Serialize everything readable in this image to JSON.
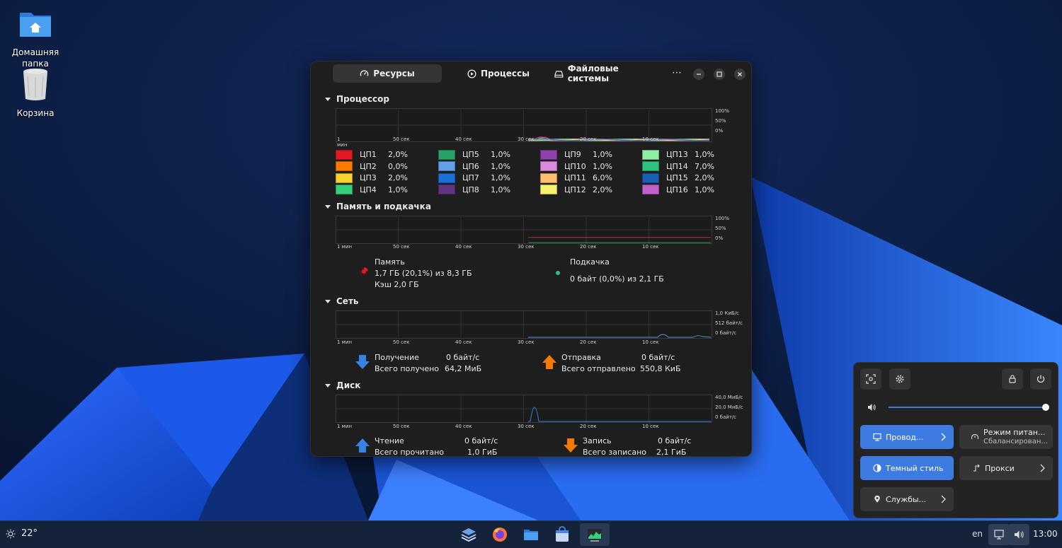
{
  "colors": {
    "accent": "#3d7be0",
    "window_bg": "#1e1e1e",
    "graph_line": "#d2382f",
    "swap_dot": "#2ec27e"
  },
  "desktop": {
    "icons": [
      {
        "label": "Домашняя папка",
        "icon": "home-folder-icon"
      },
      {
        "label": "Корзина",
        "icon": "trash-icon"
      }
    ]
  },
  "window": {
    "tabs": [
      {
        "label": "Ресурсы",
        "icon": "speedometer-icon",
        "active": true
      },
      {
        "label": "Процессы",
        "icon": "play-circle-icon",
        "active": false
      },
      {
        "label": "Файловые системы",
        "icon": "drive-icon",
        "active": false
      }
    ],
    "more": "⋯"
  },
  "time_ticks": [
    "1 мин",
    "50 сек",
    "40 сек",
    "30 сек",
    "20 сек",
    "10 сек"
  ],
  "cpu": {
    "title": "Процессор",
    "ylabels": [
      "100%",
      "50%",
      "0%"
    ],
    "cores": [
      {
        "name": "ЦП1",
        "value": "2,0%",
        "color": "#e01b24"
      },
      {
        "name": "ЦП2",
        "value": "0,0%",
        "color": "#ff7800"
      },
      {
        "name": "ЦП3",
        "value": "2,0%",
        "color": "#f6d32d"
      },
      {
        "name": "ЦП4",
        "value": "1,0%",
        "color": "#33d17a"
      },
      {
        "name": "ЦП5",
        "value": "1,0%",
        "color": "#26a269"
      },
      {
        "name": "ЦП6",
        "value": "1,0%",
        "color": "#62a0ea"
      },
      {
        "name": "ЦП7",
        "value": "1,0%",
        "color": "#1c71d8"
      },
      {
        "name": "ЦП8",
        "value": "1,0%",
        "color": "#613583"
      },
      {
        "name": "ЦП9",
        "value": "1,0%",
        "color": "#9141ac"
      },
      {
        "name": "ЦП10",
        "value": "1,0%",
        "color": "#dc8add"
      },
      {
        "name": "ЦП11",
        "value": "6,0%",
        "color": "#ffbe6f"
      },
      {
        "name": "ЦП12",
        "value": "2,0%",
        "color": "#f9f06b"
      },
      {
        "name": "ЦП13",
        "value": "1,0%",
        "color": "#8ff0a4"
      },
      {
        "name": "ЦП14",
        "value": "7,0%",
        "color": "#2ec27e"
      },
      {
        "name": "ЦП15",
        "value": "2,0%",
        "color": "#1a5fb4"
      },
      {
        "name": "ЦП16",
        "value": "1,0%",
        "color": "#c061cb"
      }
    ]
  },
  "memory": {
    "title": "Память и подкачка",
    "ylabels": [
      "100%",
      "50%",
      "0%"
    ],
    "mem_label": "Память",
    "mem_value": "1,7 ГБ (20,1%) из 8,3 ГБ",
    "mem_cache": "Кэш 2,0 ГБ",
    "swap_label": "Подкачка",
    "swap_value": "0 байт (0,0%) из 2,1 ГБ",
    "mem_percent": 20.1
  },
  "network": {
    "title": "Сеть",
    "ylabels": [
      "1,0 КиБ/с",
      "512 байт/с",
      "0 байт/с"
    ],
    "recv_label": "Получение",
    "recv_value": "0 байт/с",
    "recv_total_label": "Всего получено",
    "recv_total": "64,2 МиБ",
    "send_label": "Отправка",
    "send_value": "0 байт/с",
    "send_total_label": "Всего отправлено",
    "send_total": "550,8 КиБ"
  },
  "disk": {
    "title": "Диск",
    "ylabels": [
      "40,0 МиБ/с",
      "20,0 МиБ/с",
      "0 байт/с"
    ],
    "read_label": "Чтение",
    "read_value": "0 байт/с",
    "read_total_label": "Всего прочитано",
    "read_total": "1,0 ГиБ",
    "write_label": "Запись",
    "write_value": "0 байт/с",
    "write_total_label": "Всего записано",
    "write_total": "2,1 ГиБ"
  },
  "quick_settings": {
    "volume_percent": 100,
    "tiles": [
      {
        "label": "Провод...",
        "on": true,
        "icon": "wired-network-icon",
        "chevron": true
      },
      {
        "label": "Режим питан...",
        "sub": "Сбалансирован...",
        "on": false,
        "icon": "power-mode-icon",
        "chevron": false
      },
      {
        "label": "Темный стиль",
        "on": true,
        "icon": "dark-style-icon",
        "chevron": false
      },
      {
        "label": "Прокси",
        "on": false,
        "icon": "proxy-icon",
        "chevron": true
      },
      {
        "label": "Службы...",
        "on": false,
        "icon": "location-icon",
        "chevron": true
      }
    ]
  },
  "taskbar": {
    "weather": "22°",
    "lang": "en",
    "clock": "13:00",
    "apps": [
      "layers-icon",
      "firefox-icon",
      "files-icon",
      "software-icon",
      "system-monitor-icon"
    ]
  }
}
